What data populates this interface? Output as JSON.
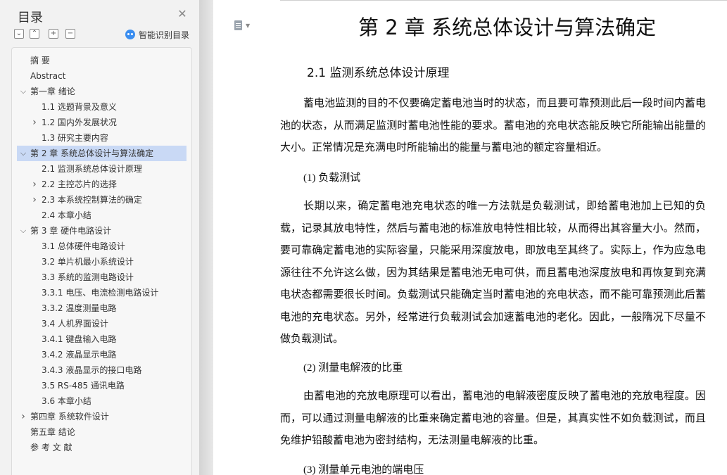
{
  "sidebar": {
    "title": "目录",
    "close_glyph": "✕",
    "tools": [
      {
        "name": "collapse-all-icon",
        "glyph": "⌄"
      },
      {
        "name": "expand-all-icon",
        "glyph": "⌃"
      },
      {
        "name": "add-heading-icon",
        "glyph": "+"
      },
      {
        "name": "remove-heading-icon",
        "glyph": "−"
      }
    ],
    "smart_toc_label": "智能识别目录",
    "items": [
      {
        "label": "摘  要",
        "level": 0,
        "chevron": ""
      },
      {
        "label": "Abstract",
        "level": 0,
        "chevron": ""
      },
      {
        "label": "第一章    绪论",
        "level": 0,
        "chevron": "expanded"
      },
      {
        "label": "1.1    选题背景及意义",
        "level": 1,
        "chevron": ""
      },
      {
        "label": "1.2    国内外发展状况",
        "level": 1,
        "chevron": "collapsed"
      },
      {
        "label": "1.3    研究主要内容",
        "level": 1,
        "chevron": ""
      },
      {
        "label": "第 2 章  系统总体设计与算法确定",
        "level": 0,
        "chevron": "expanded",
        "active": true
      },
      {
        "label": "2.1  监测系统总体设计原理",
        "level": 1,
        "chevron": ""
      },
      {
        "label": "2.2  主控芯片的选择",
        "level": 1,
        "chevron": "collapsed"
      },
      {
        "label": "2.3  本系统控制算法的确定",
        "level": 1,
        "chevron": "collapsed"
      },
      {
        "label": "2.4  本章小结",
        "level": 1,
        "chevron": ""
      },
      {
        "label": "第 3 章  硬件电路设计",
        "level": 0,
        "chevron": "expanded"
      },
      {
        "label": "3.1  总体硬件电路设计",
        "level": 1,
        "chevron": ""
      },
      {
        "label": "3.2  单片机最小系统设计",
        "level": 1,
        "chevron": ""
      },
      {
        "label": "3.3  系统的监测电路设计",
        "level": 1,
        "chevron": ""
      },
      {
        "label": "3.3.1  电压、电流检测电路设计",
        "level": 1,
        "chevron": ""
      },
      {
        "label": "3.3.2  温度测量电路",
        "level": 1,
        "chevron": ""
      },
      {
        "label": "3.4  人机界面设计",
        "level": 1,
        "chevron": ""
      },
      {
        "label": "3.4.1  键盘输入电路",
        "level": 1,
        "chevron": ""
      },
      {
        "label": "3.4.2  液晶显示电路",
        "level": 1,
        "chevron": ""
      },
      {
        "label": "3.4.3  液晶显示的接口电路",
        "level": 1,
        "chevron": ""
      },
      {
        "label": "3.5 RS-485 通讯电路",
        "level": 1,
        "chevron": ""
      },
      {
        "label": "3.6  本章小结",
        "level": 1,
        "chevron": ""
      },
      {
        "label": "第四章  系统软件设计",
        "level": 0,
        "chevron": "collapsed"
      },
      {
        "label": "第五章  结论",
        "level": 0,
        "chevron": ""
      },
      {
        "label": "参 考 文 献",
        "level": 0,
        "chevron": ""
      }
    ]
  },
  "document": {
    "chapter_title": "第 2 章  系统总体设计与算法确定",
    "section_title": "2.1  监测系统总体设计原理",
    "para1": "蓄电池监测的目的不仅要确定蓄电池当时的状态，而且要可靠预测此后一段时间内蓄电池的状态，从而满足监测时蓄电池性能的要求。蓄电池的充电状态能反映它所能输出能量的大小。正常情况是充满电时所能输出的能量与蓄电池的额定容量相近。",
    "sub1_num": "(1)",
    "sub1_text": "负载测试",
    "para2": "长期以来，确定蓄电池充电状态的唯一方法就是负载测试，即给蓄电池加上已知的负载，记录其放电特性，然后与蓄电池的标准放电特性相比较，从而得出其容量大小。然而，要可靠确定蓄电池的实际容量，只能采用深度放电，即放电至其终了。实际上，作为应急电源往往不允许这么做，因为其结果是蓄电池无电可供，而且蓄电池深度放电和再恢复到充满电状态都需要很长时间。负载测试只能确定当时蓄电池的充电状态，而不能可靠预测此后蓄电池的充电状态。另外，经常进行负载测试会加速蓄电池的老化。因此，一般隋况下尽量不做负载测试。",
    "sub2_num": "(2)",
    "sub2_text": "测量电解液的比重",
    "para3": "由蓄电池的充放电原理可以看出，蓄电池的电解液密度反映了蓄电池的充放电程度。因而，可以通过测量电解液的比重来确定蓄电池的容量。但是，其真实性不如负载测试，而且免维护铅酸蓄电池为密封结构，无法测量电解液的比重。",
    "sub3_num": "(3)",
    "sub3_text": "测量单元电池的端电压"
  }
}
